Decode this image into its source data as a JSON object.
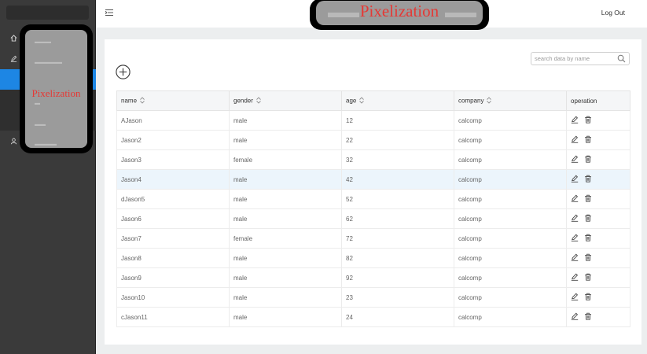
{
  "header": {
    "logout_label": "Log Out",
    "overlay_label": "Pixelization"
  },
  "sidebar": {
    "overlay_label": "Pixelization"
  },
  "toolbar": {
    "search_placeholder": "search data by name"
  },
  "table": {
    "columns": [
      "name",
      "gender",
      "age",
      "company",
      "operation"
    ],
    "rows": [
      [
        "AJason",
        "male",
        "12",
        "calcomp"
      ],
      [
        "Jason2",
        "male",
        "22",
        "calcomp"
      ],
      [
        "Jason3",
        "female",
        "32",
        "calcomp"
      ],
      [
        "Jason4",
        "male",
        "42",
        "calcomp"
      ],
      [
        "dJason5",
        "male",
        "52",
        "calcomp"
      ],
      [
        "Jason6",
        "male",
        "62",
        "calcomp"
      ],
      [
        "Jason7",
        "female",
        "72",
        "calcomp"
      ],
      [
        "Jason8",
        "male",
        "82",
        "calcomp"
      ],
      [
        "Jason9",
        "male",
        "92",
        "calcomp"
      ],
      [
        "Jason10",
        "male",
        "23",
        "calcomp"
      ],
      [
        "cJason11",
        "male",
        "24",
        "calcomp"
      ]
    ]
  },
  "colors": {
    "accent": "#1d86e4",
    "sidebar_bg": "#3a3a3a",
    "row_highlight": "#ecf5fc",
    "overlay_text": "#e53935"
  }
}
